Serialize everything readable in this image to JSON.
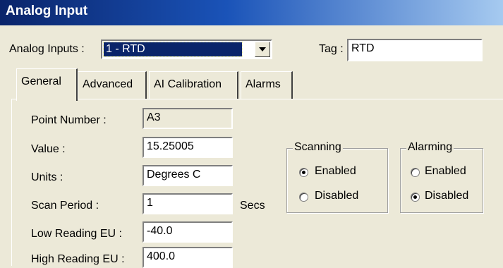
{
  "window": {
    "title": "Analog Input"
  },
  "selector": {
    "label": "Analog Inputs :",
    "value": "1 - RTD",
    "tag_label": "Tag :",
    "tag_value": "RTD"
  },
  "tabs": [
    {
      "label": "General",
      "active": true
    },
    {
      "label": "Advanced",
      "active": false
    },
    {
      "label": "AI Calibration",
      "active": false
    },
    {
      "label": "Alarms",
      "active": false
    }
  ],
  "general": {
    "point_number": {
      "label": "Point Number :",
      "value": "A3"
    },
    "value": {
      "label": "Value :",
      "value": "15.25005"
    },
    "units": {
      "label": "Units :",
      "value": "Degrees C"
    },
    "scan_period": {
      "label": "Scan Period :",
      "value": "1",
      "unit": "Secs"
    },
    "low_reading": {
      "label": "Low Reading EU :",
      "value": "-40.0"
    },
    "high_reading": {
      "label": "High Reading EU :",
      "value": "400.0"
    }
  },
  "scanning": {
    "title": "Scanning",
    "enabled_label": "Enabled",
    "disabled_label": "Disabled",
    "selected": "Enabled"
  },
  "alarming": {
    "title": "Alarming",
    "enabled_label": "Enabled",
    "disabled_label": "Disabled",
    "selected": "Disabled"
  },
  "icons": {
    "dropdown": "chevron-down-icon"
  }
}
